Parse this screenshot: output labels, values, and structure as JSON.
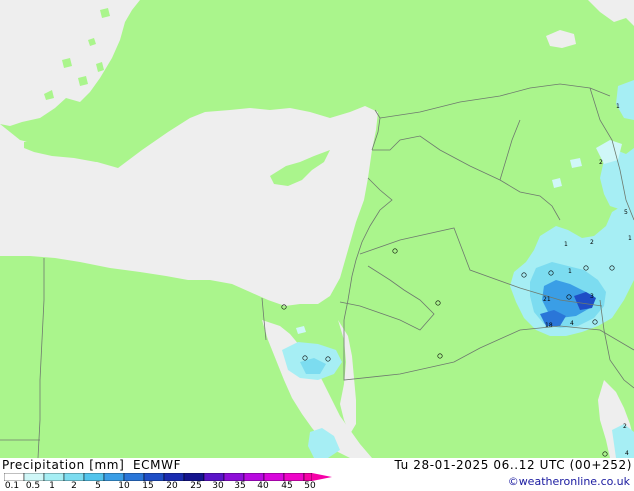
{
  "map": {
    "colors": {
      "land": "#aaf58c",
      "sea": "#eeeeee",
      "border": "#6e7a6e"
    },
    "cell_values": [
      "1",
      "2",
      "5",
      "1",
      "1",
      "2",
      "0",
      "1",
      "0",
      "0",
      "0",
      "21",
      "0",
      "3",
      "4",
      "18",
      "0",
      "0",
      "0",
      "0",
      "0",
      "0",
      "0",
      "2",
      "4",
      "0"
    ]
  },
  "legend": {
    "title": "Precipitation [mm]",
    "model": "ECMWF",
    "colors": [
      "#ffffff",
      "#d0f7f8",
      "#a6eef4",
      "#7cdcf0",
      "#52c4ec",
      "#3a9ee6",
      "#2a76d8",
      "#1e4ec6",
      "#1a2cb0",
      "#14148e",
      "#5a14c8",
      "#8e0ed8",
      "#b80ae0",
      "#d806dc",
      "#ee04c8",
      "#f602a8"
    ],
    "ticks": [
      "0.1",
      "0.5",
      "1",
      "2",
      "5",
      "10",
      "15",
      "20",
      "25",
      "30",
      "35",
      "40",
      "45",
      "50"
    ]
  },
  "datetime": "Tu 28-01-2025 06..12 UTC (00+252)",
  "credit": "©weatheronline.co.uk"
}
